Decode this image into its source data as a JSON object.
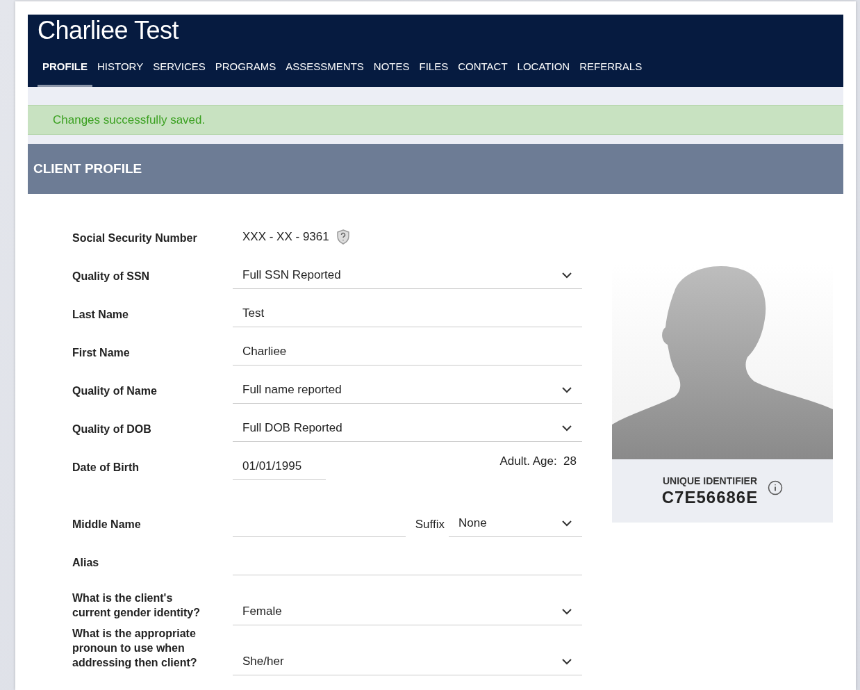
{
  "client_name": "Charliee Test",
  "tabs": [
    {
      "label": "PROFILE",
      "selected": true
    },
    {
      "label": "HISTORY",
      "selected": false
    },
    {
      "label": "SERVICES",
      "selected": false
    },
    {
      "label": "PROGRAMS",
      "selected": false
    },
    {
      "label": "ASSESSMENTS",
      "selected": false
    },
    {
      "label": "NOTES",
      "selected": false
    },
    {
      "label": "FILES",
      "selected": false
    },
    {
      "label": "CONTACT",
      "selected": false
    },
    {
      "label": "LOCATION",
      "selected": false
    },
    {
      "label": "REFERRALS",
      "selected": false
    }
  ],
  "alert": "Changes successfully saved.",
  "section_title": "CLIENT PROFILE",
  "fields": [
    {
      "kind": "masked",
      "label": "Social Security Number",
      "value": "XXX - XX - 9361"
    },
    {
      "kind": "select",
      "label": "Quality of SSN",
      "value": "Full SSN Reported"
    },
    {
      "kind": "input",
      "label": "Last Name",
      "value": "Test"
    },
    {
      "kind": "input",
      "label": "First Name",
      "value": "Charliee"
    },
    {
      "kind": "select",
      "label": "Quality of Name",
      "value": "Full name reported"
    },
    {
      "kind": "select",
      "label": "Quality of DOB",
      "value": "Full DOB Reported"
    },
    {
      "kind": "date",
      "label": "Date of Birth",
      "value": "01/01/1995",
      "age_label": "Adult. Age:",
      "age": "28"
    },
    {
      "kind": "suffix",
      "label": "Middle Name",
      "suffix_label": "Suffix",
      "suffix_value": "None"
    },
    {
      "kind": "input",
      "label": "Alias"
    },
    {
      "kind": "select",
      "label": "What is the client's current gender identity?",
      "value": "Female"
    },
    {
      "kind": "select",
      "label": "What is the appropriate pronoun to use when addressing then client?",
      "value": "She/her"
    }
  ],
  "identifier": {
    "label": "UNIQUE IDENTIFIER",
    "value": "C7E56686E"
  }
}
